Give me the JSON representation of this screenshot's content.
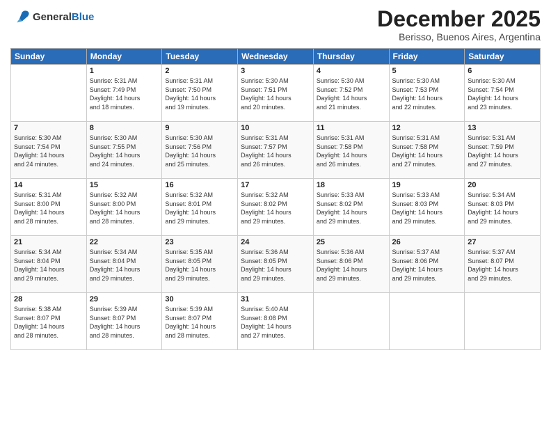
{
  "logo": {
    "general": "General",
    "blue": "Blue"
  },
  "title": "December 2025",
  "subtitle": "Berisso, Buenos Aires, Argentina",
  "headers": [
    "Sunday",
    "Monday",
    "Tuesday",
    "Wednesday",
    "Thursday",
    "Friday",
    "Saturday"
  ],
  "weeks": [
    [
      {
        "day": "",
        "content": ""
      },
      {
        "day": "1",
        "content": "Sunrise: 5:31 AM\nSunset: 7:49 PM\nDaylight: 14 hours\nand 18 minutes."
      },
      {
        "day": "2",
        "content": "Sunrise: 5:31 AM\nSunset: 7:50 PM\nDaylight: 14 hours\nand 19 minutes."
      },
      {
        "day": "3",
        "content": "Sunrise: 5:30 AM\nSunset: 7:51 PM\nDaylight: 14 hours\nand 20 minutes."
      },
      {
        "day": "4",
        "content": "Sunrise: 5:30 AM\nSunset: 7:52 PM\nDaylight: 14 hours\nand 21 minutes."
      },
      {
        "day": "5",
        "content": "Sunrise: 5:30 AM\nSunset: 7:53 PM\nDaylight: 14 hours\nand 22 minutes."
      },
      {
        "day": "6",
        "content": "Sunrise: 5:30 AM\nSunset: 7:54 PM\nDaylight: 14 hours\nand 23 minutes."
      }
    ],
    [
      {
        "day": "7",
        "content": "Sunrise: 5:30 AM\nSunset: 7:54 PM\nDaylight: 14 hours\nand 24 minutes."
      },
      {
        "day": "8",
        "content": "Sunrise: 5:30 AM\nSunset: 7:55 PM\nDaylight: 14 hours\nand 24 minutes."
      },
      {
        "day": "9",
        "content": "Sunrise: 5:30 AM\nSunset: 7:56 PM\nDaylight: 14 hours\nand 25 minutes."
      },
      {
        "day": "10",
        "content": "Sunrise: 5:31 AM\nSunset: 7:57 PM\nDaylight: 14 hours\nand 26 minutes."
      },
      {
        "day": "11",
        "content": "Sunrise: 5:31 AM\nSunset: 7:58 PM\nDaylight: 14 hours\nand 26 minutes."
      },
      {
        "day": "12",
        "content": "Sunrise: 5:31 AM\nSunset: 7:58 PM\nDaylight: 14 hours\nand 27 minutes."
      },
      {
        "day": "13",
        "content": "Sunrise: 5:31 AM\nSunset: 7:59 PM\nDaylight: 14 hours\nand 27 minutes."
      }
    ],
    [
      {
        "day": "14",
        "content": "Sunrise: 5:31 AM\nSunset: 8:00 PM\nDaylight: 14 hours\nand 28 minutes."
      },
      {
        "day": "15",
        "content": "Sunrise: 5:32 AM\nSunset: 8:00 PM\nDaylight: 14 hours\nand 28 minutes."
      },
      {
        "day": "16",
        "content": "Sunrise: 5:32 AM\nSunset: 8:01 PM\nDaylight: 14 hours\nand 29 minutes."
      },
      {
        "day": "17",
        "content": "Sunrise: 5:32 AM\nSunset: 8:02 PM\nDaylight: 14 hours\nand 29 minutes."
      },
      {
        "day": "18",
        "content": "Sunrise: 5:33 AM\nSunset: 8:02 PM\nDaylight: 14 hours\nand 29 minutes."
      },
      {
        "day": "19",
        "content": "Sunrise: 5:33 AM\nSunset: 8:03 PM\nDaylight: 14 hours\nand 29 minutes."
      },
      {
        "day": "20",
        "content": "Sunrise: 5:34 AM\nSunset: 8:03 PM\nDaylight: 14 hours\nand 29 minutes."
      }
    ],
    [
      {
        "day": "21",
        "content": "Sunrise: 5:34 AM\nSunset: 8:04 PM\nDaylight: 14 hours\nand 29 minutes."
      },
      {
        "day": "22",
        "content": "Sunrise: 5:34 AM\nSunset: 8:04 PM\nDaylight: 14 hours\nand 29 minutes."
      },
      {
        "day": "23",
        "content": "Sunrise: 5:35 AM\nSunset: 8:05 PM\nDaylight: 14 hours\nand 29 minutes."
      },
      {
        "day": "24",
        "content": "Sunrise: 5:36 AM\nSunset: 8:05 PM\nDaylight: 14 hours\nand 29 minutes."
      },
      {
        "day": "25",
        "content": "Sunrise: 5:36 AM\nSunset: 8:06 PM\nDaylight: 14 hours\nand 29 minutes."
      },
      {
        "day": "26",
        "content": "Sunrise: 5:37 AM\nSunset: 8:06 PM\nDaylight: 14 hours\nand 29 minutes."
      },
      {
        "day": "27",
        "content": "Sunrise: 5:37 AM\nSunset: 8:07 PM\nDaylight: 14 hours\nand 29 minutes."
      }
    ],
    [
      {
        "day": "28",
        "content": "Sunrise: 5:38 AM\nSunset: 8:07 PM\nDaylight: 14 hours\nand 28 minutes."
      },
      {
        "day": "29",
        "content": "Sunrise: 5:39 AM\nSunset: 8:07 PM\nDaylight: 14 hours\nand 28 minutes."
      },
      {
        "day": "30",
        "content": "Sunrise: 5:39 AM\nSunset: 8:07 PM\nDaylight: 14 hours\nand 28 minutes."
      },
      {
        "day": "31",
        "content": "Sunrise: 5:40 AM\nSunset: 8:08 PM\nDaylight: 14 hours\nand 27 minutes."
      },
      {
        "day": "",
        "content": ""
      },
      {
        "day": "",
        "content": ""
      },
      {
        "day": "",
        "content": ""
      }
    ]
  ]
}
